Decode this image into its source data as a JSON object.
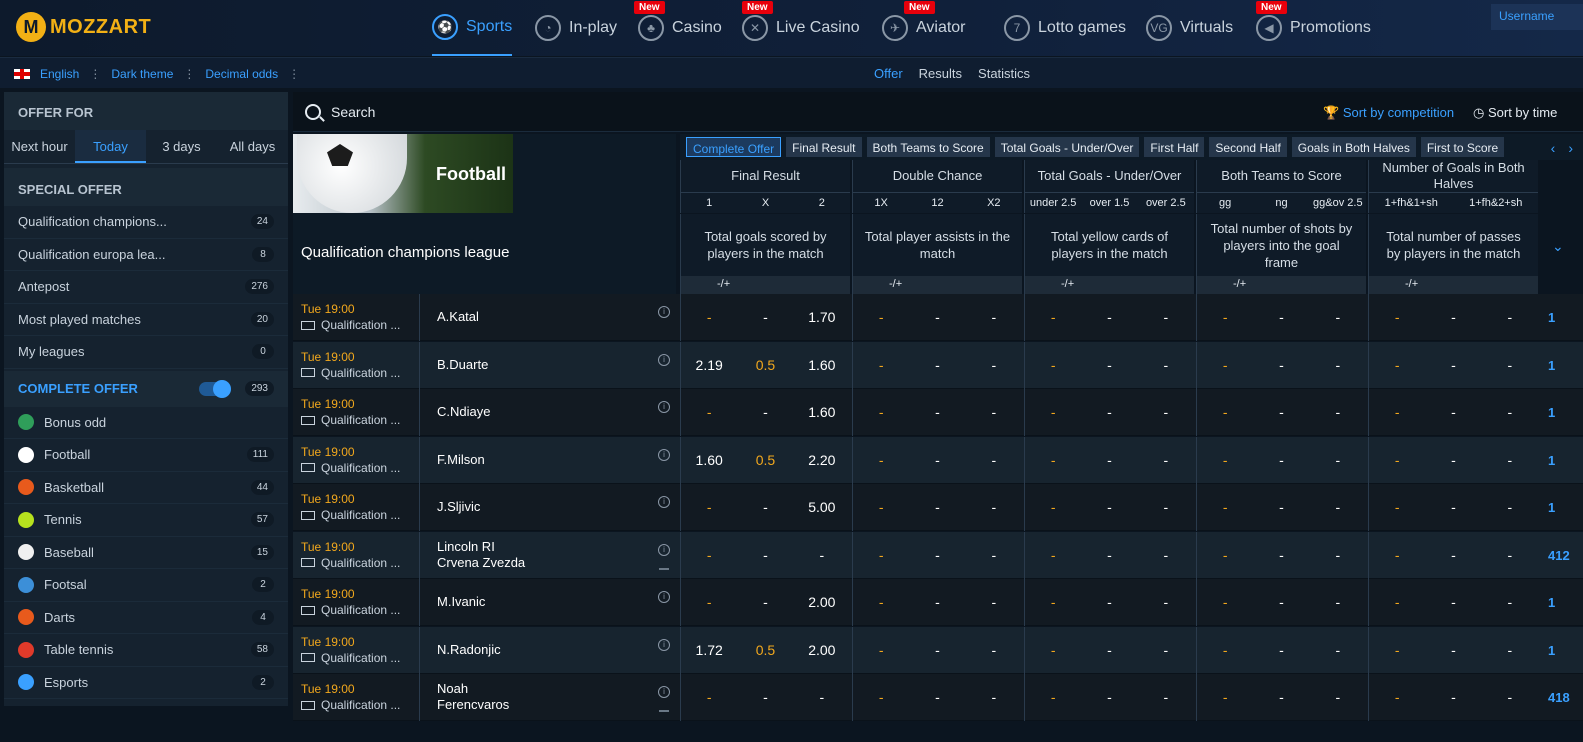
{
  "brand": {
    "name": "MOZZART"
  },
  "nav": [
    {
      "label": "Sports",
      "new": false,
      "active": true,
      "icon": "soccer-ball-icon"
    },
    {
      "label": "In-play",
      "new": false,
      "active": false,
      "icon": "stopwatch-icon"
    },
    {
      "label": "Casino",
      "new": true,
      "active": false,
      "icon": "cherries-icon"
    },
    {
      "label": "Live Casino",
      "new": true,
      "active": false,
      "icon": "chip-icon"
    },
    {
      "label": "Aviator",
      "new": true,
      "active": false,
      "icon": "plane-icon"
    },
    {
      "label": "Lotto games",
      "new": false,
      "active": false,
      "icon": "lotto-ball-icon"
    },
    {
      "label": "Virtuals",
      "new": false,
      "active": false,
      "icon": "virtuals-icon"
    },
    {
      "label": "Promotions",
      "new": true,
      "active": false,
      "icon": "megaphone-icon"
    }
  ],
  "new_label": "New",
  "user": {
    "label": "Username"
  },
  "settings": {
    "language": "English",
    "theme": "Dark theme",
    "odds": "Decimal odds"
  },
  "subnav": {
    "offer": "Offer",
    "results": "Results",
    "statistics": "Statistics"
  },
  "sidebar": {
    "offer_for": "OFFER FOR",
    "tabs": [
      "Next hour",
      "Today",
      "3 days",
      "All days"
    ],
    "active_tab": "Today",
    "special_offer": "SPECIAL OFFER",
    "special": [
      {
        "label": "Qualification champions...",
        "count": "24"
      },
      {
        "label": "Qualification europa lea...",
        "count": "8"
      },
      {
        "label": "Antepost",
        "count": "276"
      },
      {
        "label": "Most played matches",
        "count": "20"
      },
      {
        "label": "My leagues",
        "count": "0"
      }
    ],
    "complete_offer": {
      "label": "COMPLETE OFFER",
      "count": "293",
      "toggle_on": true
    },
    "sports": [
      {
        "label": "Bonus odd",
        "count": "",
        "color": "#2f9e5a"
      },
      {
        "label": "Football",
        "count": "111",
        "color": "#ffffff"
      },
      {
        "label": "Basketball",
        "count": "44",
        "color": "#e85a1c"
      },
      {
        "label": "Tennis",
        "count": "57",
        "color": "#b7e21e"
      },
      {
        "label": "Baseball",
        "count": "15",
        "color": "#f0f0f0"
      },
      {
        "label": "Footsal",
        "count": "2",
        "color": "#3c8fd8"
      },
      {
        "label": "Darts",
        "count": "4",
        "color": "#e85a1c"
      },
      {
        "label": "Table tennis",
        "count": "58",
        "color": "#e03a2a"
      },
      {
        "label": "Esports",
        "count": "2",
        "color": "#3aa0ff"
      }
    ]
  },
  "search": {
    "placeholder": "Search",
    "sort_competition": "Sort by competition",
    "sort_time": "Sort by time"
  },
  "league": {
    "sport": "Football",
    "name": "Qualification champions league"
  },
  "market_tabs": [
    "Complete Offer",
    "Final Result",
    "Both Teams to Score",
    "Total Goals - Under/Over",
    "First Half",
    "Second Half",
    "Goals in Both Halves",
    "First to Score"
  ],
  "markets": [
    {
      "title": "Final Result",
      "cols": [
        "1",
        "X",
        "2"
      ],
      "desc": "Total goals scored by players in the match"
    },
    {
      "title": "Double Chance",
      "cols": [
        "1X",
        "12",
        "X2"
      ],
      "desc": "Total player assists in the match"
    },
    {
      "title": "Total Goals - Under/Over",
      "cols": [
        "under 2.5",
        "over 1.5",
        "over 2.5"
      ],
      "desc": "Total yellow cards of players in the match"
    },
    {
      "title": "Both Teams to Score",
      "cols": [
        "gg",
        "ng",
        "gg&ov 2.5"
      ],
      "desc": "Total number of shots by players into the goal frame"
    },
    {
      "title": "Number of Goals in Both Halves",
      "cols": [
        "1+fh&1+sh",
        "1+fh&2+sh"
      ],
      "desc": "Total number of passes by players in the match"
    }
  ],
  "spec_label": "-/+",
  "matches": [
    {
      "time": "Tue 19:00",
      "league": "Qualification ...",
      "players": [
        "A.Katal"
      ],
      "odds": [
        "-",
        "-",
        "1.70"
      ],
      "mid": "-",
      "more": "1",
      "stat": false
    },
    {
      "time": "Tue 19:00",
      "league": "Qualification ...",
      "players": [
        "B.Duarte"
      ],
      "odds": [
        "2.19",
        "0.5",
        "1.60"
      ],
      "mid": "0.5",
      "more": "1",
      "stat": false
    },
    {
      "time": "Tue 19:00",
      "league": "Qualification ...",
      "players": [
        "C.Ndiaye"
      ],
      "odds": [
        "-",
        "-",
        "1.60"
      ],
      "mid": "-",
      "more": "1",
      "stat": false
    },
    {
      "time": "Tue 19:00",
      "league": "Qualification ...",
      "players": [
        "F.Milson"
      ],
      "odds": [
        "1.60",
        "0.5",
        "2.20"
      ],
      "mid": "0.5",
      "more": "1",
      "stat": false
    },
    {
      "time": "Tue 19:00",
      "league": "Qualification ...",
      "players": [
        "J.Sljivic"
      ],
      "odds": [
        "-",
        "-",
        "5.00"
      ],
      "mid": "-",
      "more": "1",
      "stat": false
    },
    {
      "time": "Tue 19:00",
      "league": "Qualification ...",
      "players": [
        "Lincoln RI",
        "Crvena Zvezda"
      ],
      "odds": [
        "-",
        "-",
        "-"
      ],
      "mid": "-",
      "more": "412",
      "stat": true
    },
    {
      "time": "Tue 19:00",
      "league": "Qualification ...",
      "players": [
        "M.Ivanic"
      ],
      "odds": [
        "-",
        "-",
        "2.00"
      ],
      "mid": "-",
      "more": "1",
      "stat": false
    },
    {
      "time": "Tue 19:00",
      "league": "Qualification ...",
      "players": [
        "N.Radonjic"
      ],
      "odds": [
        "1.72",
        "0.5",
        "2.00"
      ],
      "mid": "0.5",
      "more": "1",
      "stat": false
    },
    {
      "time": "Tue 19:00",
      "league": "Qualification ...",
      "players": [
        "Noah",
        "Ferencvaros"
      ],
      "odds": [
        "-",
        "-",
        "-"
      ],
      "mid": "-",
      "more": "418",
      "stat": true
    }
  ],
  "colors": {
    "accent": "#3aa0ff",
    "odds_highlight": "#f2a81d",
    "new_badge": "#e8000b",
    "brand": "#f2b015"
  }
}
